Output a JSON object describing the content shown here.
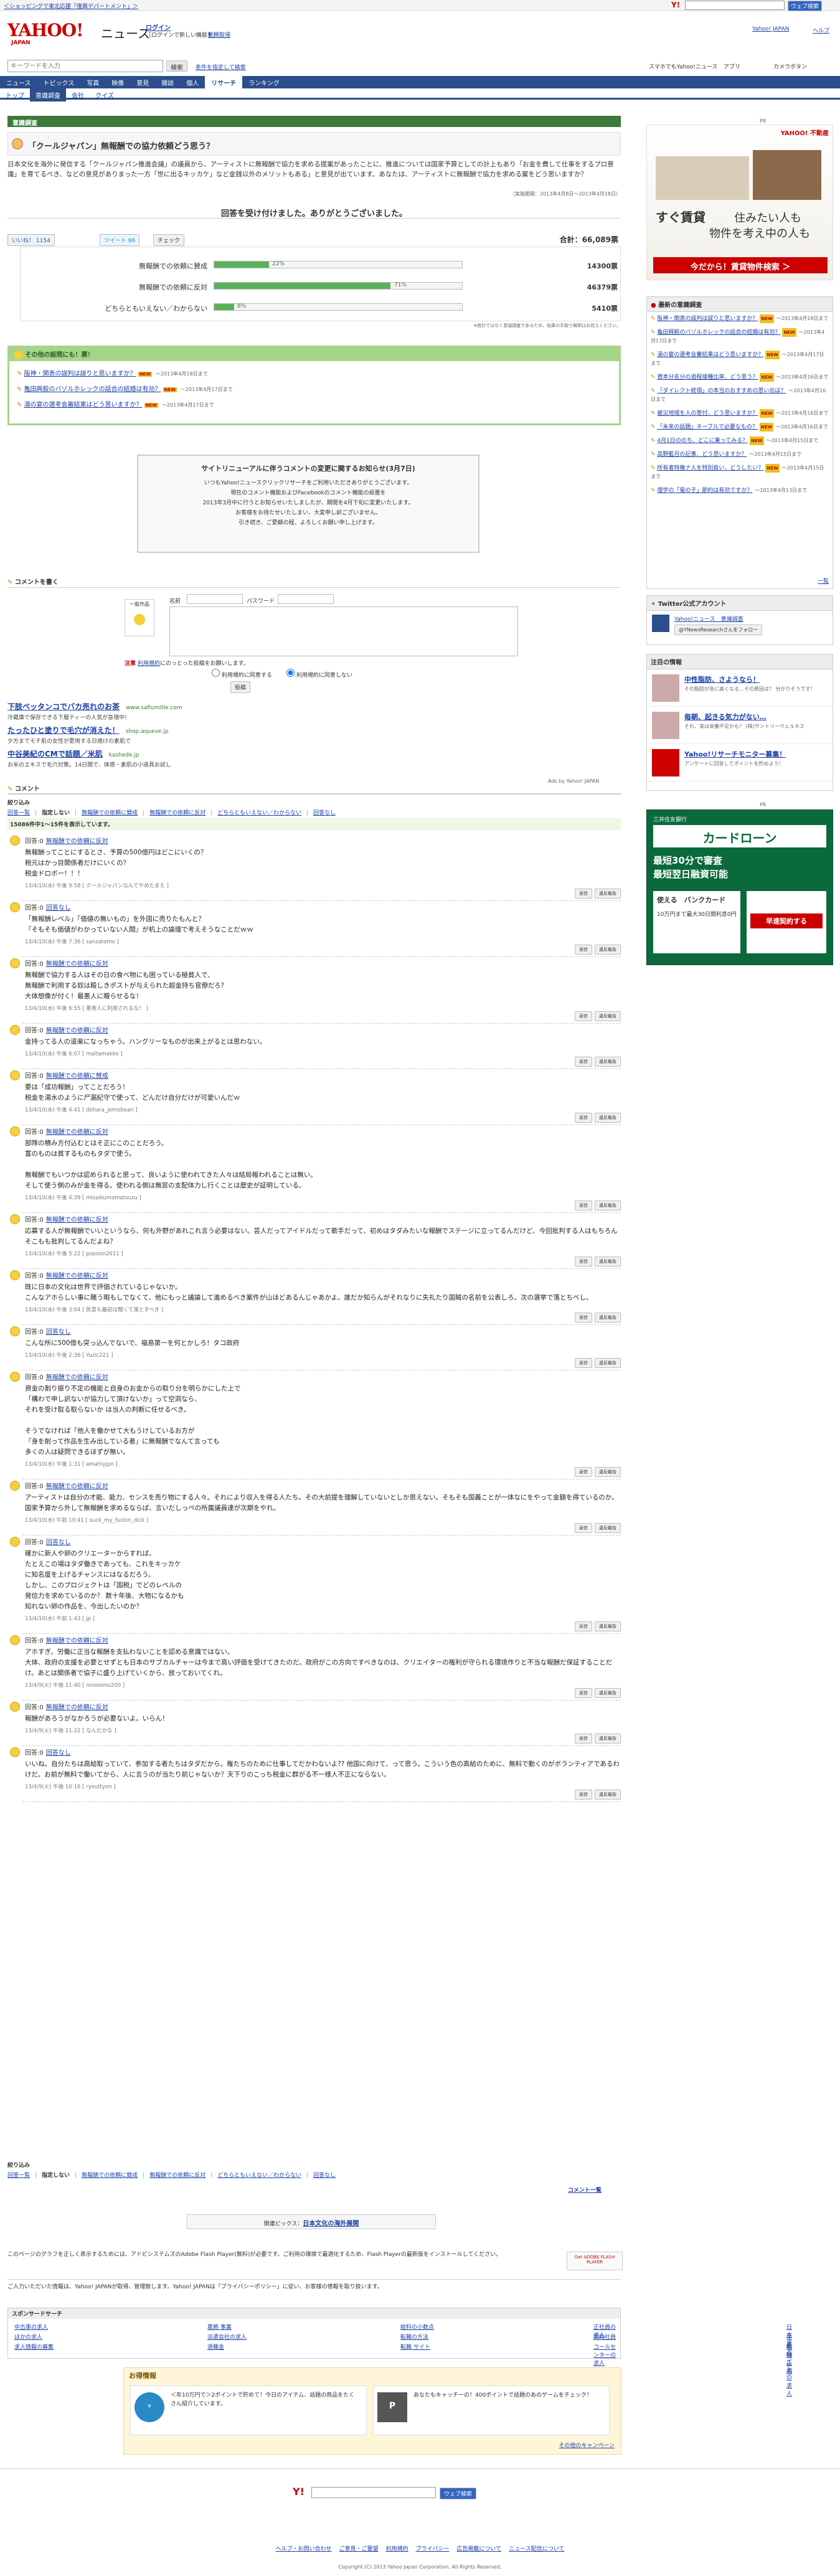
{
  "topbar": {
    "promo": "＜ショッピングで東北応援「復興デパートメント」＞",
    "yahoo_link": "Yahoo! JAPAN",
    "help": "ヘルプ"
  },
  "header": {
    "logo": "YAHOO! JAPAN",
    "site": "ニュース",
    "login": "ログイン",
    "login_sub": "［ログインで新しい機能を］",
    "register": "新規取得"
  },
  "search": {
    "placeholder": "キーワードを入力",
    "button": "検索",
    "conditions": "条件を指定して検索",
    "phone": "スマホでもYahoo!ニュース",
    "app": "アプリ",
    "camera": "カメラボタン"
  },
  "gnav": [
    "ニュース",
    "トピックス",
    "写真",
    "映像",
    "意見",
    "雑誌",
    "個人",
    "リサーチ",
    "ランキング"
  ],
  "gnav_active": "リサーチ",
  "snav": [
    "トップ",
    "意識調査",
    "会社",
    "クイズ"
  ],
  "snav_active": "意識調査",
  "category": "意識調査",
  "question": {
    "title": "「クールジャパン」無報酬での協力依頼どう思う？",
    "body": "日本文化を海外に発信する「クールジャパン推進会議」の議員から、アーティストに無報酬で協力を求める提案があったことに、推進については国家予算としての計上もあり「お金を費して仕事をするプロ意識」を育てるべき、などの意見がありまった一方「世に出るキッカケ」など金銭以外のメリットもある」と意見が出ています。あなたは、アーティストに無報酬で協力を求める案をどう思いますか？",
    "period": "（実施期間：2013年4月8日〜2013年4月18日）"
  },
  "result": {
    "thanks": "回答を受け付けました。ありがとうございました。",
    "total_label": "合計：",
    "total": "66,089票",
    "like": "いいね！",
    "like_count": "1154",
    "tweet": "ツイート",
    "tweet_count": "66",
    "check": "チェック",
    "note": "※統計ではなく意識調査であるため、結果の手取り解釈はお控えください。",
    "rows": [
      {
        "label": "無報酬での依頼に賛成",
        "pct_text": "22%",
        "votes": "14300票",
        "pct": 0.22
      },
      {
        "label": "無報酬での依頼に反対",
        "pct_text": "71%",
        "votes": "46379票",
        "pct": 0.71
      },
      {
        "label": "どちらともいえない／わからない",
        "pct_text": "8%",
        "votes": "5410票",
        "pct": 0.08
      }
    ]
  },
  "related": {
    "heading": "その他の設問にも！票！",
    "items": [
      {
        "text": "阪神・関表の誤判は誤りと思いますか？",
        "period": "〜2013年4月18日まで"
      },
      {
        "text": "亀田興毅のバゾルホレックの話合の結婚は有効？",
        "period": "〜2013年4月17日まで"
      },
      {
        "text": "湯の宴の選考会審結果はどう思いますか？",
        "period": "〜2013年4月17日まで"
      }
    ]
  },
  "notice": {
    "title": "サイトリニューアルに伴うコメントの変更に関するお知らせ(3月7日)",
    "lines": [
      "いつもYahoo!ニュースクリックリサーチをご利用いただきありがとうございます。",
      "現在のコメント機能およびFacebookのコメント機能の設置を",
      "2013年3月中に行うとお知らせいたしましたが、期間を4月下旬に変更いたします。",
      "お客様をお待たせいたしまい、大変申し訳ございません。",
      "引き続き、ご愛顧の程、よろしくお願い申し上げます。"
    ]
  },
  "comment_form": {
    "heading": "コメントを書く",
    "avatar_label": "一般作品",
    "name_label": "名前",
    "pass_label": "パスワード",
    "caution": "注意",
    "terms": "利用規約",
    "terms_tail": "にのっとった投稿をお願いします。",
    "opt1": "利用規約に同意する",
    "opt2": "利用規約に同意しない",
    "submit": "投稿"
  },
  "ads": [
    {
      "title": "下肢ベッタンコでバカ売れのお茶",
      "url": "www.safiumitle.com",
      "desc": "冷蔵庫で保存できる下層ティーの人気が急増中!"
    },
    {
      "title": "たったひと塗りで毛穴が消えた！",
      "url": "shop.aqueve.jp",
      "desc": "夕方までモチ肌の女性が愛用する日焼けの素肌で"
    },
    {
      "title": "中谷美紀のCMで話題／米肌",
      "url": "kashede.jp",
      "desc": "お米のエキスで毛穴対策。14日間で、体感・素肌の小道具お試し"
    }
  ],
  "ads_by": "Ads by Yahoo! JAPAN",
  "comments_heading": "コメント",
  "filter": {
    "label": "絞り込み",
    "links": [
      "回答一覧",
      "指定しない",
      "無報酬での依頼に賛成",
      "無報酬での依頼に反対",
      "どちらともいえない／わからない",
      "回答なし"
    ]
  },
  "count_text": "15086件中1〜15件を表示しています。",
  "reply_label": "返信",
  "report_label": "違反報告",
  "comments": [
    {
      "vote": "回答:0",
      "tag": "無報酬での依頼に反対",
      "text": [
        "無報酬ってことにするとさ、予算の500億円はどこにいくの？",
        "税元はかっ目関係者だけにいくの？",
        "税金ドロボー！！！"
      ],
      "meta": "13/4/10(水) 午後 9:58 [ クールジャパンなんてやめたまえ ]"
    },
    {
      "vote": "回答:0",
      "tag": "回答なし",
      "text": [
        "「無報酬レベル」「価値の無いもの」を外国に売りたもんと？",
        "『そもそも価値がわかっていない人間』が机上の論理で考えそうなことだｗｗ"
      ],
      "meta": "13/4/10(水) 午後 7:36 [ sanzatomo ]"
    },
    {
      "vote": "回答:0",
      "tag": "無報酬での依頼に反対",
      "text": [
        "無報酬で協力する人はその日の食べ物にも困っている極貧人で、",
        "無報酬で利用する奴は殿しきポストが与えられた超金持ち官僚だろ？",
        "大体想像が付く！最悪人に贈らせるな！"
      ],
      "meta": "13/4/10(水) 午後 6:55 [ 悪者人に利用されるな！ ]"
    },
    {
      "vote": "回答:0",
      "tag": "無報酬での依頼に反対",
      "text": [
        "金持ってる人の道楽になっちゃう。ハングリーなものが出来上がるとは思わない。"
      ],
      "meta": "13/4/10(水) 午後 6:07 [ maltamakko ]"
    },
    {
      "vote": "回答:0",
      "tag": "無報酬での依頼に賛成",
      "text": [
        "要は「成功報酬」ってことだろう！",
        "税金を湯水のように尸漏紀守で使って、どんだけ自分だけが可愛いんだｗ"
      ],
      "meta": "13/4/10(水) 午後 4:41 [ dohara_jemobean ]"
    },
    {
      "vote": "回答:0",
      "tag": "無報酬での依頼に反対",
      "text": [
        "部隊の積み方付込むとはそ正にこのことだろう。",
        "富のものは貧するものもタダで使う。",
        "",
        "無報酬でもいつかは認められると思って、良いように使われてきた人々は結局報われることは無い。",
        "そして使う側のみが金を得る。使われる側は無窓の支配体力し行くことは歴史が証明している。"
      ],
      "meta": "13/4/10(水) 午後 4:39 [ misaikumomatsuzu ]"
    },
    {
      "vote": "回答:0",
      "tag": "無報酬での依頼に反対",
      "text": [
        "応募する人が無報酬でいいというなら、何も外野があれこれ言う必要はない。芸人だってアイドルだって歌手だって、初めはタダみたいな報酬でステージに立ってるんだけど、今回批判する人はもちろんそこもも批判してるんだよね？"
      ],
      "meta": "13/4/10(水) 午後 5:22 [ popoon2011 ]"
    },
    {
      "vote": "回答:0",
      "tag": "無報酬での依頼に反対",
      "text": [
        "既に日本の文化は世界で評価されているじゃないか。",
        "こんなアホらしい事に賭う暇もしでなくて、他にもっと議論して進めるべき案件が山ほどあるんじゃあかよ。誰だか知らんがそれなりに失礼たり国賊の名前を公表しろ。次の選挙で落とちべし。"
      ],
      "meta": "13/4/10(水) 午後 3:04 [ 民意も最初は聞くて落とすべき ]"
    },
    {
      "vote": "回答:0",
      "tag": "回答なし",
      "text": [
        "こんな所に500億も突っ込んでないで、福島第一を何とかしろ！タコ政府"
      ],
      "meta": "13/4/10(水) 午後 2:36 [ Yuzic221 ]"
    },
    {
      "vote": "回答:0",
      "tag": "無報酬での依頼に反対",
      "text": [
        "資金の割り振り不定の機能と自身のお金からの取り分を明らかにした上で",
        "「構わで申し訳ないが協力して頂けないか」って空洞なら、",
        "それを受け取る取らないか は当人の判断に任せるべき。",
        "",
        "そうでなければ「他人を働かせて大もうけしているお方が",
        "『身を削って作品を生み出している者』に無報酬でなんて言っても",
        "多くの人は疑問できるほずが無い。"
      ],
      "meta": "13/4/10(水) 午後 1:31 [ amahiyjpn ]"
    },
    {
      "vote": "回答:0",
      "tag": "無報酬での依頼に反対",
      "text": [
        "アーティストは自分の才能、能力、センスを売り物にする人々。それにより収入を得る人たち。その大前提を理解していないとしか思えない。そもそも国義ことが一体なにをやって金額を得ているのか。国家予算から外して無報酬を求めるならば、言いだしっぺの所属議員達が次期をやれ。"
      ],
      "meta": "13/4/10(水) 午前 10:41 [ suck_my_fuckin_dick ]"
    },
    {
      "vote": "回答:0",
      "tag": "回答なし",
      "text": [
        "確かに新人や卵のクリエーターからすれば、",
        "たとえこの場はタダ働きであっても、これをキッカケ",
        "に知名度を上げるチャンスにはなるだろう。",
        "しかし、このプロジェクトは「国税」でどのレベルの",
        "発信力を求めているのか？ 数十年後、大物になるかも",
        "知れない卵の作品を、今出したいのか？"
      ],
      "meta": "13/4/10(水) 午前 1:43 [ jp ]"
    },
    {
      "vote": "回答:0",
      "tag": "無報酬での依頼に反対",
      "text": [
        "アホすぎ。労働に正当な報酬を支払わないことを認める意識ではない。",
        "大体、政府の支援を必要とせずとも日本のサブカルチャーは今まで高い評価を受けてきたのだ。政府がこの方向ですべきなのは、クリエイターの権利が守られる環境作りと不当な報酬だ保証することだけ。あとは関係者で協子に盛り上げていくから、放っておいてくれ。"
      ],
      "meta": "13/4/9(火) 午後 11:40 [ nnooomo200 ]"
    },
    {
      "vote": "回答:0",
      "tag": "無報酬での依頼に反対",
      "text": [
        "報酬があろうがなかろうが必要ないよ。いらん！"
      ],
      "meta": "13/4/9(火) 午後 11:22 [ なんだかな ]"
    },
    {
      "vote": "回答:0",
      "tag": "回答なし",
      "text": [
        "いいね。自分たちは高給取っていて、参加する者たちはタダだから。権たちのために仕事してだかわないよ?? 他国に向けて、って思う。こういう色の高給のために、無料で動くのがボランティアであるわけだ。お前が無料で働いてから、人に言うのが当たり前じゃないか？天下りのこっち税金に群がる不一様人不正にならない。"
      ],
      "meta": "13/4/9(火) 午後 10:16 [ ryouttyon ]"
    }
  ],
  "more_comments": "コメント一覧",
  "topics": {
    "label": "関連ピックス：",
    "link": "日本文化の海外展開"
  },
  "flash": {
    "text": "このページのグラフを正しく表示するためには、アドビシステムズのAdobe Flash Player(無料)が必要です。ご利用の環境で最適化するため、Flash Playerの最新版をインストールしてください。",
    "badge": "Get ADOBE FLASH PLAYER"
  },
  "privacy": {
    "text": "ご入力いただいた情報は、Yahoo! JAPANが取得、管理致します。Yahoo! JAPANは「プライバシーポリシー」に従い、お客様の情報を取り扱います。",
    "link": "プライバシーポリシー"
  },
  "sponsored": {
    "heading": "スポンサードサーチ",
    "links": [
      "中古車の求人",
      "葛飾 事業",
      "給料の小数点",
      "正社員の求人",
      "日本 求人",
      "ほかの求人",
      "派遣会社の求人",
      "転職の方法",
      "契約社員",
      "単発バイトの求人",
      "求人情報の募集",
      "退職金",
      "転職 サイト",
      "コールセンターの求人",
      "転職 正規"
    ]
  },
  "deals": {
    "heading": "お得情報",
    "item1": "＜年10万円で＞2ポイントで貯めて！今日のアイテム、話題の商品をたくさん紹介しています。",
    "item2": "あなたもキャッチーの！400ポイントで話題のあのゲームをチェック！",
    "more": "その他のキャンペーン"
  },
  "footer": {
    "links": [
      "ヘルプ・お問い合わせ",
      "ご意見・ご要望",
      "利用規約",
      "プライバシー",
      "広告掲載について",
      "ニュース配信について"
    ],
    "copyright": "Copyright (C) 2013 Yahoo Japan Corporation. All Rights Reserved.",
    "search_button": "ウェブ検索"
  },
  "sidebar": {
    "pr": "PR",
    "ad1": {
      "brand": "YAHOO! 不動産",
      "tag1": "すぐ賃貸",
      "tag2": "住みたい人も",
      "tag3": "物件を考え中の人も",
      "cta": "今だから！賃貸物件検索 ＞"
    },
    "survey_heading": "最新の意識調査",
    "surveys": [
      {
        "text": "阪神・関表の誤判は誤りと思いますか？",
        "period": "〜2013年4月18日まで",
        "new": true
      },
      {
        "text": "亀田興毅のバゾルホレックの話合の結婚は有効？",
        "period": "〜2013年4月17日まで",
        "new": true
      },
      {
        "text": "湯の宴の選考会審結果はどう思いますか？",
        "period": "〜2013年4月17日まで",
        "new": true
      },
      {
        "text": "資本分名分の過程接種比率、どう思う？",
        "period": "〜2013年4月16日まで",
        "new": true
      },
      {
        "text": "「ダイレクト統領」の本当のおすすめの思い出は？",
        "period": "〜2013年4月16日まで",
        "new": false
      },
      {
        "text": "被災地域を人の寄付、どう思いますか？",
        "period": "〜2013年4月16日まで",
        "new": true
      },
      {
        "text": "「未来の話題」ネーブルで必要なもの？",
        "period": "〜2013年4月16日まで",
        "new": true
      },
      {
        "text": "4月1日ののち、どこに乗ってみる？",
        "period": "〜2013年4月15日まで",
        "new": true
      },
      {
        "text": "高野藍月の記事、どう思いますか？",
        "period": "〜2013年4月15日まで",
        "new": false
      },
      {
        "text": "所有者特権ナ人を特別扱い、どうしたい？",
        "period": "〜2013年4月15日まで",
        "new": true
      },
      {
        "text": "理学の「菊の子」節約は有効ですか？",
        "period": "〜2013年4月13日まで",
        "new": false
      }
    ],
    "more": "一覧",
    "twitter_heading": "Twitter公式アカウント",
    "twitter_name": "Yahoo!ニュース　意識調査",
    "twitter_follow": "@YNewsResearchさんをフォロー",
    "attention_heading": "注目の情報",
    "attention": [
      {
        "title": "中性脂肪、さようなら！",
        "desc": "その脂肪が急に高くなる…その原因は？ 分かりそうです！"
      },
      {
        "title": "毎朝、起きる気力がない…",
        "desc": "それ、実は栄養不足かも？ (株)サントリーウェルネス"
      },
      {
        "title": "Yahoo!リサーチモニター募集！",
        "desc": "アンケートに回答してポイントを貯めよう！"
      }
    ],
    "ad2": {
      "bank": "三井住友銀行",
      "product": "カードローン",
      "line1": "最短30分で審査",
      "line2": "最短翌日融資可能",
      "line3": "使える　バンクカード",
      "line4": "10万円まで最大30日間利息0円",
      "apply": "早速契約する"
    }
  }
}
